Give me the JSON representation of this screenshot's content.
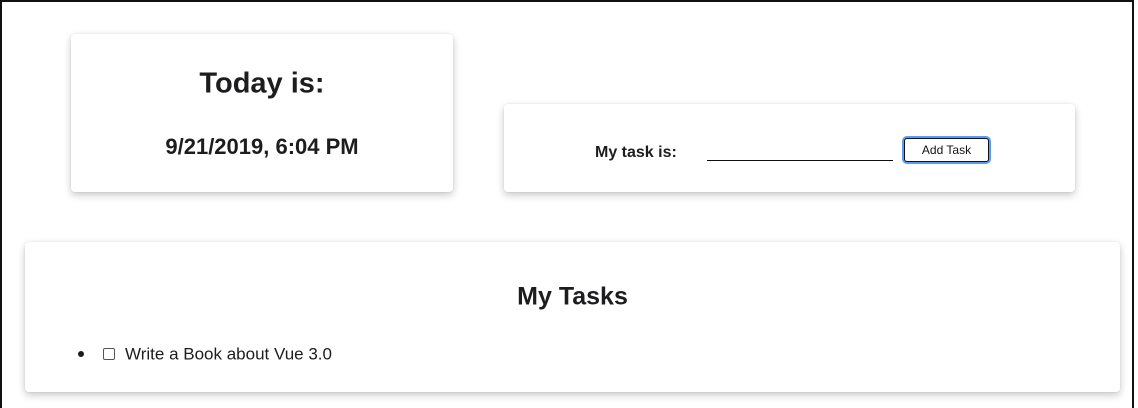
{
  "today_card": {
    "heading": "Today is:",
    "datetime": "9/21/2019, 6:04 PM"
  },
  "task_form": {
    "label": "My task is:",
    "input_value": "",
    "button_label": "Add Task",
    "focus_color": "#5b9bf3"
  },
  "tasks_card": {
    "heading": "My Tasks",
    "items": [
      {
        "label": "Write a Book about Vue 3.0",
        "checked": false
      }
    ]
  }
}
